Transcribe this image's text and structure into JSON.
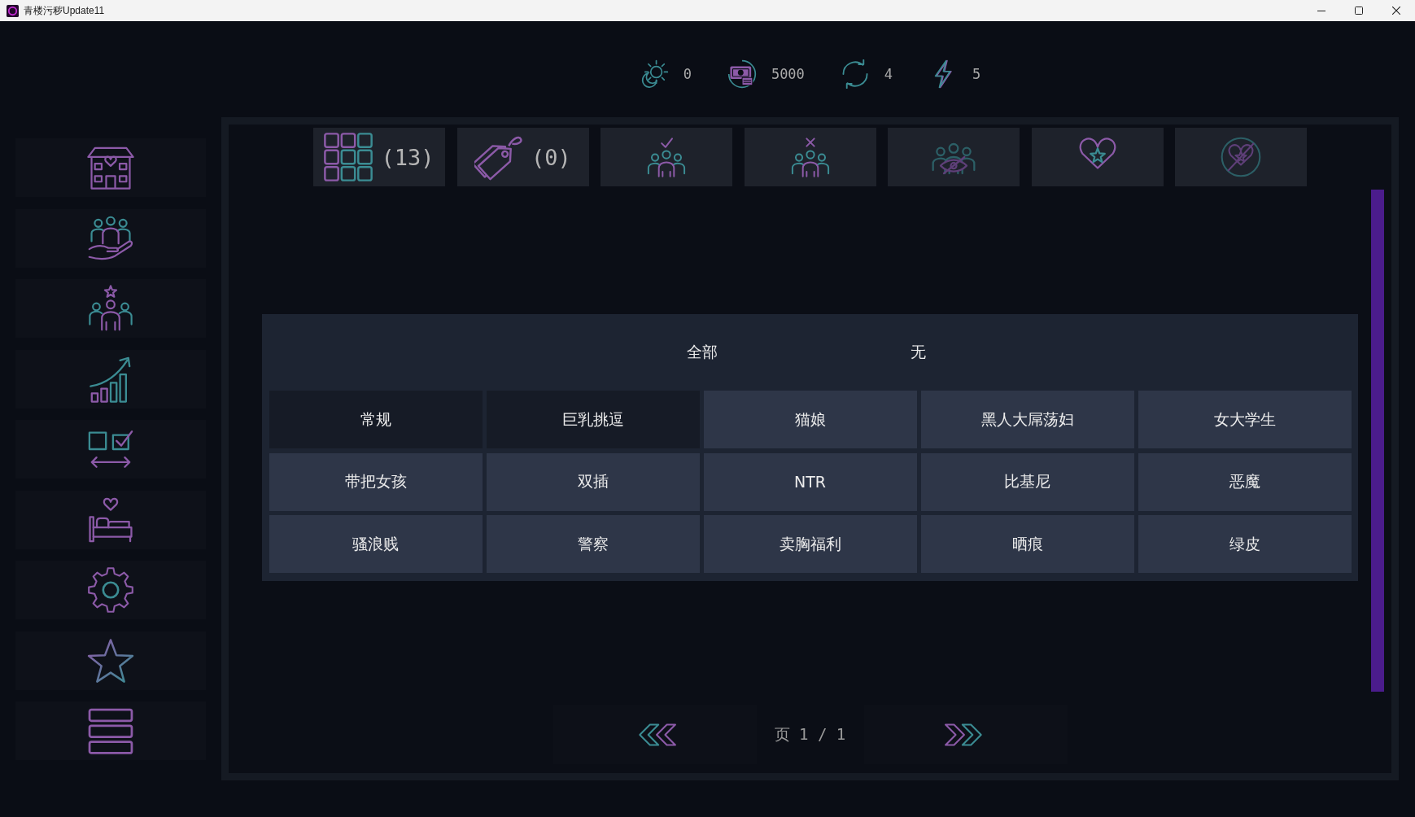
{
  "window": {
    "title": "青楼污秽Update11"
  },
  "stats": [
    {
      "kind": "day",
      "value": "0"
    },
    {
      "kind": "money",
      "value": "5000"
    },
    {
      "kind": "turns",
      "value": "4"
    },
    {
      "kind": "energy",
      "value": "5"
    }
  ],
  "sidebar": {
    "items": [
      {
        "kind": "house"
      },
      {
        "kind": "care"
      },
      {
        "kind": "team"
      },
      {
        "kind": "growth"
      },
      {
        "kind": "compare"
      },
      {
        "kind": "bed"
      },
      {
        "kind": "gear"
      },
      {
        "kind": "star"
      },
      {
        "kind": "menu"
      }
    ]
  },
  "filter_tabs": [
    {
      "kind": "grid",
      "count": "(13)"
    },
    {
      "kind": "tag",
      "count": "(0)"
    },
    {
      "kind": "groupcheck"
    },
    {
      "kind": "groupcross"
    },
    {
      "kind": "groupeye"
    },
    {
      "kind": "heartstar"
    },
    {
      "kind": "heartcross"
    }
  ],
  "tag_panel": {
    "options": [
      "全部",
      "无"
    ],
    "tags": [
      {
        "label": "常规",
        "selected": true
      },
      {
        "label": "巨乳挑逗",
        "selected": true
      },
      {
        "label": "猫娘",
        "selected": false
      },
      {
        "label": "黑人大屌荡妇",
        "selected": false
      },
      {
        "label": "女大学生",
        "selected": false
      },
      {
        "label": "带把女孩",
        "selected": false
      },
      {
        "label": "双插",
        "selected": false
      },
      {
        "label": "NTR",
        "selected": false
      },
      {
        "label": "比基尼",
        "selected": false
      },
      {
        "label": "恶魔",
        "selected": false
      },
      {
        "label": "骚浪贱",
        "selected": false
      },
      {
        "label": "警察",
        "selected": false
      },
      {
        "label": "卖胸福利",
        "selected": false
      },
      {
        "label": "晒痕",
        "selected": false
      },
      {
        "label": "绿皮",
        "selected": false
      }
    ]
  },
  "pagination": {
    "page": "页 1 / 1"
  }
}
